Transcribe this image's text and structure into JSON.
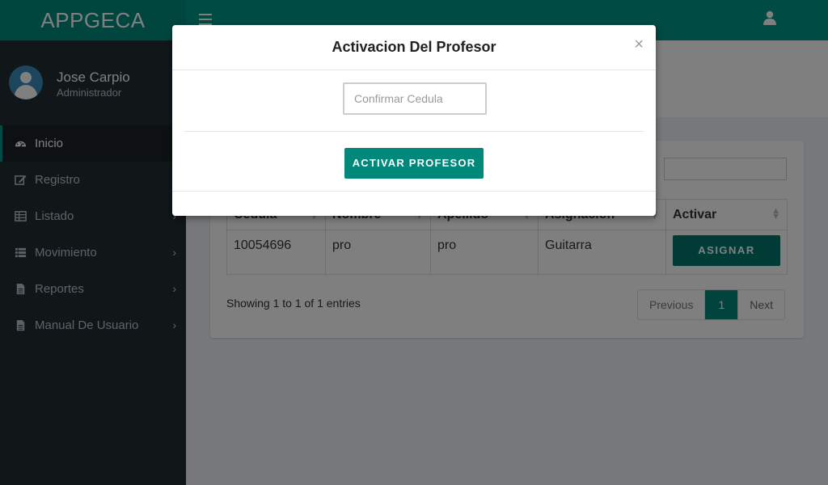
{
  "app": {
    "logo": "APPGECA"
  },
  "user": {
    "name": "Jose Carpio",
    "role": "Administrador"
  },
  "sidebar": {
    "items": [
      {
        "label": "Inicio",
        "icon": "dashboard-icon",
        "active": true,
        "has_children": false
      },
      {
        "label": "Registro",
        "icon": "edit-icon",
        "active": false,
        "has_children": false
      },
      {
        "label": "Listado",
        "icon": "table-icon",
        "active": false,
        "has_children": true
      },
      {
        "label": "Movimiento",
        "icon": "list-icon",
        "active": false,
        "has_children": true
      },
      {
        "label": "Reportes",
        "icon": "file-icon",
        "active": false,
        "has_children": true
      },
      {
        "label": "Manual De Usuario",
        "icon": "file-icon",
        "active": false,
        "has_children": true
      }
    ]
  },
  "search": {
    "label": ":"
  },
  "table": {
    "headers": [
      "Cedula",
      "Nombre",
      "Apellido",
      "Asignacion",
      "Activar"
    ],
    "rows": [
      {
        "cedula": "10054696",
        "nombre": "pro",
        "apellido": "pro",
        "asignacion": "Guitarra",
        "action": "ASIGNAR"
      }
    ]
  },
  "pagination": {
    "info": "Showing 1 to 1 of 1 entries",
    "previous": "Previous",
    "current": "1",
    "next": "Next"
  },
  "modal": {
    "title": "Activacion Del Profesor",
    "close": "×",
    "input_placeholder": "Confirmar Cedula",
    "submit_label": "ACTIVAR PROFESOR"
  },
  "colors": {
    "primary": "#009688",
    "logo_bg": "#008d7c",
    "sidebar_bg": "#222d32",
    "button": "#00897b"
  }
}
